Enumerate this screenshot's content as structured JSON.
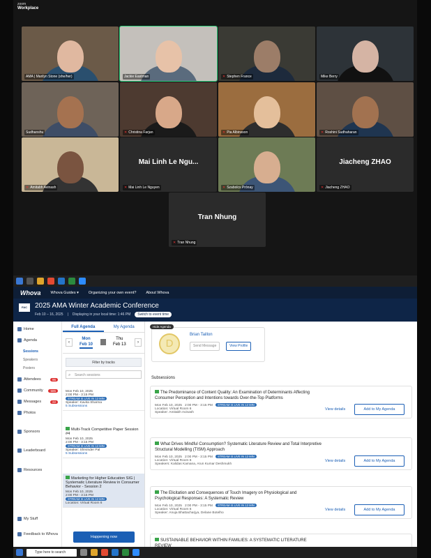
{
  "zoom": {
    "brand": "zoom",
    "product": "Workplace"
  },
  "participants": [
    {
      "name": "AMA | Marilyn Stone (she/her)",
      "muted": false,
      "bg": "#6b5a48",
      "shirt": "#2a4f6e",
      "skin": "#e0b8a0"
    },
    {
      "name": "Jackie Eastman",
      "muted": false,
      "bg": "#c4c0bb",
      "shirt": "#5a6b7d",
      "skin": "#e7c2a8",
      "active": true
    },
    {
      "name": "Stephen France",
      "muted": true,
      "bg": "#3a3a34",
      "shirt": "#1d2a3c",
      "skin": "#9c7d68"
    },
    {
      "name": "Mike Berry",
      "muted": false,
      "bg": "#2d3338",
      "shirt": "#111",
      "skin": "#d5b4a4"
    },
    {
      "name": "Sudhanshu",
      "muted": false,
      "bg": "#6e6358",
      "shirt": "#3e4d66",
      "skin": "#a57250"
    },
    {
      "name": "Christina Farjan",
      "muted": true,
      "bg": "#4d3a30",
      "shirt": "#1a1a1a",
      "skin": "#d8a889"
    },
    {
      "name": "Pia Albinsson",
      "muted": true,
      "bg": "#9b6d3f",
      "shirt": "#2d2d2d",
      "skin": "#e4bf9b"
    },
    {
      "name": "Roshini Sudhaharan",
      "muted": true,
      "bg": "#5e4f44",
      "shirt": "#1f3550",
      "skin": "#a27250"
    },
    {
      "name": "Amitabh Avinash",
      "muted": true,
      "bg": "#c9b797",
      "shirt": "#333",
      "skin": "#7a5440"
    },
    {
      "name": "Mai Linh Le Nguyen",
      "muted": true,
      "display": "Mai Linh Le Ngu..."
    },
    {
      "name": "Szabolcs Prónay",
      "muted": true,
      "bg": "#6d7b55",
      "shirt": "#3c5576",
      "skin": "#d7ae90"
    },
    {
      "name": "Jiacheng ZHAO",
      "muted": true,
      "display": "Jiacheng ZHAO"
    },
    {
      "name": "Tran Nhung",
      "muted": true,
      "display": "Tran Nhung"
    }
  ],
  "browser_nav": {
    "logo": "Whova",
    "items": [
      "Whova Guides ▾",
      "Organizing your own event?",
      "About Whova"
    ]
  },
  "header": {
    "badge": "FAC",
    "title": "2025 AMA Winter Academic Conference",
    "dates": "Feb 10 – 16, 2025",
    "tz": "Displaying in your local time: 1:46 PM",
    "switch": "Switch to event time"
  },
  "sidebar": {
    "items": [
      {
        "label": "Home"
      },
      {
        "label": "Agenda"
      },
      {
        "label": "Sessions",
        "sub": true,
        "sel": true
      },
      {
        "label": "Speakers",
        "sub": true
      },
      {
        "label": "Posters",
        "sub": true
      },
      {
        "label": "Attendees",
        "count": "96"
      },
      {
        "label": "Community",
        "count": "585"
      },
      {
        "label": "Messages",
        "count": "22"
      },
      {
        "label": "Photos"
      },
      {
        "label": "Sponsors"
      },
      {
        "label": "Leaderboard"
      },
      {
        "label": "Resources"
      },
      {
        "label": "My Stuff"
      },
      {
        "label": "Feedback to Whova"
      }
    ]
  },
  "agenda": {
    "tabs": [
      "Full Agenda",
      "My Agenda"
    ],
    "day1": {
      "dow": "Mon",
      "date": "Feb 10"
    },
    "day2": {
      "dow": "Thu",
      "date": "Feb 13"
    },
    "filter": "Filter by tracks",
    "search": "Search sessions",
    "cards": [
      {
        "title": "",
        "date": "Mon Feb 10, 2025",
        "time": "2:00 PM - 3:15 PM",
        "live": "STREAM IS LIVE IN 13 MIN",
        "speaker": "Speaker: Kavita Sharma",
        "subs": "5 Subsessions"
      },
      {
        "title": "Multi-Track Competitive Paper Session #4",
        "date": "Mon Feb 10, 2025",
        "time": "2:00 PM - 3:15 PM",
        "live": "STREAM IS LIVE IN 13 MIN",
        "speaker": "Speaker: Shrvinder Pal",
        "subs": "5 Subsessions"
      },
      {
        "title": "Marketing for Higher Education SIG | Systematic Literature Review in Consumer Behavior - Session 2",
        "date": "Mon Feb 10, 2025",
        "time": "2:00 PM - 3:15 PM",
        "live": "STREAM IS LIVE IN 13 MIN",
        "speaker": "Location: Virtual Room 6",
        "subs": ""
      }
    ],
    "happening": "Happening now"
  },
  "main": {
    "hide": "Hide Agenda",
    "speaker": {
      "initial": "D",
      "name": "Brian Taillon",
      "send": "Send Message",
      "view": "View Profile"
    },
    "subs_label": "Subsessions",
    "subsessions": [
      {
        "title": "The Predominance of Content Quality: An Examination of Determinants Affecting Consumer Perception and Intentions towards Over-the-Top Platforms",
        "date": "Mon Feb 10, 2025",
        "time": "2:00 PM - 3:15 PM",
        "live": "STREAM IS LIVE IN 13 MIN",
        "loc": "Location: Virtual Room 6",
        "spk": "Speaker: Amitabh Avinash"
      },
      {
        "title": "What Drives Mindful Consumption? Systematic Literature Review and Total Interpretive Structural Modelling (TISM) Approach",
        "date": "Mon Feb 10, 2025",
        "time": "2:00 PM - 3:15 PM",
        "live": "STREAM IS LIVE IN 13 MIN",
        "loc": "Location: Virtual Room 6",
        "spk": "Speakers: Kalidas Kamana, Arun Kumar Deshmukh"
      },
      {
        "title": "The Elicitation and Consequences of Touch Imagery on Physiological and Psychological Responses: A Systematic Review",
        "date": "Mon Feb 10, 2025",
        "time": "2:00 PM - 3:15 PM",
        "live": "STREAM IS LIVE IN 13 MIN",
        "loc": "Location: Virtual Room 6",
        "spk": "Speaker: Anuja Bhattacharjya, Delane Botelho"
      },
      {
        "title": "SUSTAINABLE BEHAVIOR WITHIN FAMILIES: A SYSTEMATIC LITERATURE REVIEW",
        "date": "",
        "time": "",
        "live": "",
        "loc": "",
        "spk": ""
      }
    ],
    "view_details": "View details",
    "add": "Add to My Agenda"
  },
  "taskbar": {
    "search": "Type here to search"
  }
}
